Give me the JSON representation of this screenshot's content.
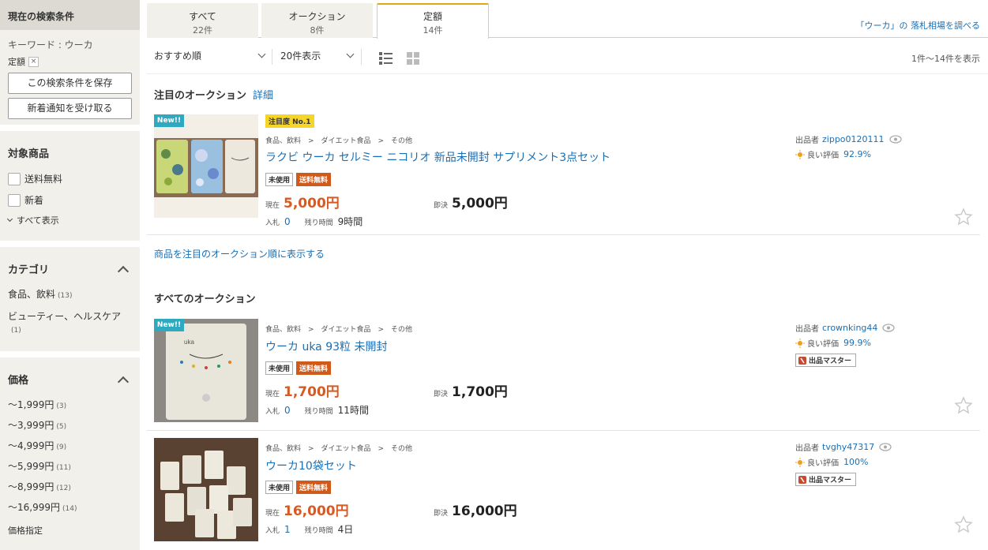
{
  "sidebar": {
    "current_conditions_title": "現在の検索条件",
    "keyword": "キーワード : ウーカ",
    "condition_tag": "定額",
    "remove_symbol": "×",
    "save_button": "この検索条件を保存",
    "notify_button": "新着通知を受け取る",
    "target_title": "対象商品",
    "options": [
      "送料無料",
      "新着"
    ],
    "show_all": "すべて表示",
    "category_title": "カテゴリ",
    "categories": [
      {
        "label": "食品、飲料",
        "count": "(13)"
      },
      {
        "label": "ビューティー、ヘルスケア",
        "count": "(1)"
      }
    ],
    "price_title": "価格",
    "prices": [
      {
        "label": "〜1,999円",
        "count": "(3)"
      },
      {
        "label": "〜3,999円",
        "count": "(5)"
      },
      {
        "label": "〜4,999円",
        "count": "(9)"
      },
      {
        "label": "〜5,999円",
        "count": "(11)"
      },
      {
        "label": "〜8,999円",
        "count": "(12)"
      },
      {
        "label": "〜16,999円",
        "count": "(14)"
      }
    ],
    "price_custom": "価格指定"
  },
  "tabs": [
    {
      "label": "すべて",
      "count": "22件"
    },
    {
      "label": "オークション",
      "count": "8件"
    },
    {
      "label": "定額",
      "count": "14件"
    }
  ],
  "market_link": "「ウーカ」の 落札相場を調べる",
  "toolbar": {
    "sort": "おすすめ順",
    "per_page": "20件表示",
    "range": "1件〜14件を表示"
  },
  "featured": {
    "title": "注目のオークション",
    "detail_link": "詳細",
    "show_link": "商品を注目のオークション順に表示する"
  },
  "all_title": "すべてのオークション",
  "labels": {
    "new": "New!!",
    "attention": "注目度 No.1",
    "used": "未使用",
    "free_ship": "送料無料",
    "current": "現在",
    "buy_now": "即決",
    "bids": "入札",
    "time_left": "残り時間",
    "seller": "出品者",
    "good_rating": "良い評価",
    "master": "出品マスター"
  },
  "items": [
    {
      "crumb": "食品、飲料　>　ダイエット食品　>　その他",
      "title": "ラクビ ウーカ セルミー ニコリオ 新品未開封 サプリメント3点セット",
      "current": "5,000円",
      "buy_now": "5,000円",
      "bids": "0",
      "time_left": "9時間",
      "seller": "zippo0120111",
      "rating": "92.9%",
      "master": false
    },
    {
      "crumb": "食品、飲料　>　ダイエット食品　>　その他",
      "title": "ウーカ uka 93粒 未開封",
      "current": "1,700円",
      "buy_now": "1,700円",
      "bids": "0",
      "time_left": "11時間",
      "seller": "crownking44",
      "rating": "99.9%",
      "master": true
    },
    {
      "crumb": "食品、飲料　>　ダイエット食品　>　その他",
      "title": "ウーカ10袋セット",
      "current": "16,000円",
      "buy_now": "16,000円",
      "bids": "1",
      "time_left": "4日",
      "seller": "tvghy47317",
      "rating": "100%",
      "master": true
    }
  ],
  "colors": {
    "accent_tab": "#e0a812",
    "link": "#1a6fb4",
    "price": "#d85a23",
    "free_ship": "#d05a1a",
    "new_badge": "#2fa9c0"
  }
}
